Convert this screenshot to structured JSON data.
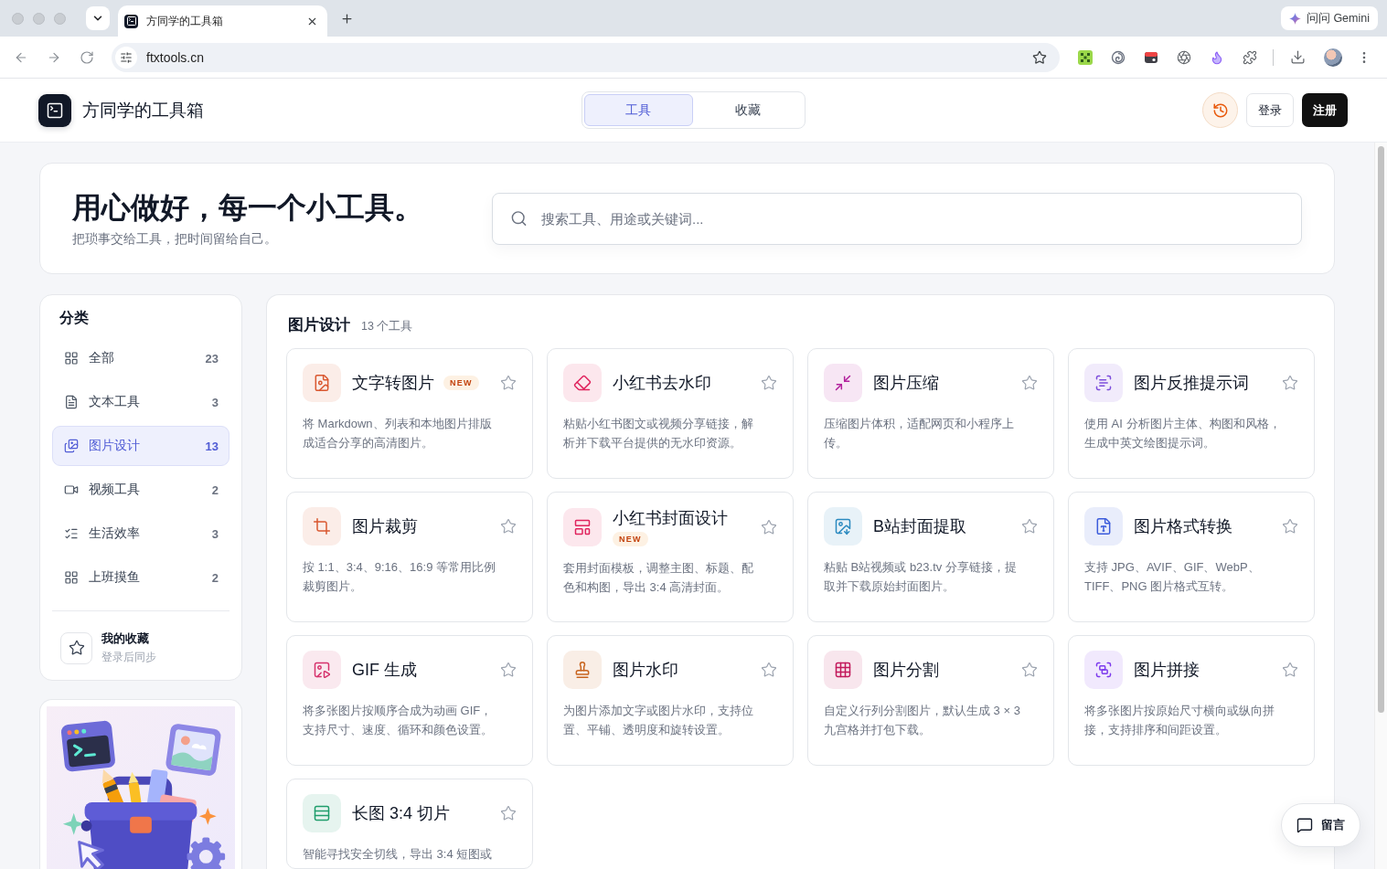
{
  "browser": {
    "tab": {
      "title": "方同学的工具箱"
    },
    "assistant_button": "问问 Gemini",
    "url": "ftxtools.cn"
  },
  "header": {
    "brand": "方同学的工具箱",
    "nav_tabs": [
      {
        "label": "工具",
        "selected": true
      },
      {
        "label": "收藏",
        "selected": false
      }
    ],
    "login": "登录",
    "register": "注册"
  },
  "hero": {
    "title": "用心做好，每一个小工具。",
    "subtitle": "把琐事交给工具，把时间留给自己。",
    "search": {
      "placeholder": "搜索工具、用途或关键词..."
    }
  },
  "sidebar": {
    "heading": "分类",
    "categories": [
      {
        "label": "全部",
        "count": "23",
        "selected": false
      },
      {
        "label": "文本工具",
        "count": "3",
        "selected": false
      },
      {
        "label": "图片设计",
        "count": "13",
        "selected": true
      },
      {
        "label": "视频工具",
        "count": "2",
        "selected": false
      },
      {
        "label": "生活效率",
        "count": "3",
        "selected": false
      },
      {
        "label": "上班摸鱼",
        "count": "2",
        "selected": false
      }
    ],
    "favorites": {
      "title": "我的收藏",
      "hint": "登录后同步"
    }
  },
  "section": {
    "title": "图片设计",
    "count": "13 个工具",
    "tools": [
      {
        "name": "文字转图片",
        "badge": "NEW",
        "description": "将 Markdown、列表和本地图片排版成适合分享的高清图片。",
        "color": "#d9572f",
        "starred": false
      },
      {
        "name": "小红书去水印",
        "description": "粘贴小红书图文或视频分享链接，解析并下载平台提供的无水印资源。",
        "color": "#e0245e",
        "starred": false
      },
      {
        "name": "图片压缩",
        "description": "压缩图片体积，适配网页和小程序上传。",
        "color": "#b21f9c",
        "starred": false
      },
      {
        "name": "图片反推提示词",
        "description": "使用 AI 分析图片主体、构图和风格，生成中英文绘图提示词。",
        "color": "#7c4ddb",
        "starred": false
      },
      {
        "name": "图片裁剪",
        "description": "按 1:1、3:4、9:16、16:9 等常用比例裁剪图片。",
        "color": "#d9572f",
        "starred": false
      },
      {
        "name": "小红书封面设计",
        "badge": "NEW",
        "description": "套用封面模板，调整主图、标题、配色和构图，导出 3:4 高清封面。",
        "color": "#e0245e",
        "starred": false
      },
      {
        "name": "B站封面提取",
        "description": "粘贴 B站视频或 b23.tv 分享链接，提取并下载原始封面图片。",
        "color": "#2b8ac0",
        "starred": false
      },
      {
        "name": "图片格式转换",
        "description": "支持 JPG、AVIF、GIF、WebP、TIFF、PNG 图片格式互转。",
        "color": "#3b5bdb",
        "starred": false
      },
      {
        "name": "GIF 生成",
        "description": "将多张图片按顺序合成为动画 GIF，支持尺寸、速度、循环和颜色设置。",
        "color": "#d6336c",
        "starred": false
      },
      {
        "name": "图片水印",
        "description": "为图片添加文字或图片水印，支持位置、平铺、透明度和旋转设置。",
        "color": "#c8641e",
        "starred": false
      },
      {
        "name": "图片分割",
        "description": "自定义行列分割图片，默认生成 3 × 3 九宫格并打包下载。",
        "color": "#c2185b",
        "starred": false
      },
      {
        "name": "图片拼接",
        "description": "将多张图片按原始尺寸横向或纵向拼接，支持排序和间距设置。",
        "color": "#7c3aed",
        "starred": false
      },
      {
        "name": "长图 3:4 切片",
        "description": "智能寻找安全切线，导出 3:4 短图或",
        "color": "#1f9d6b",
        "starred": false
      }
    ]
  },
  "feedback_button": "留言"
}
